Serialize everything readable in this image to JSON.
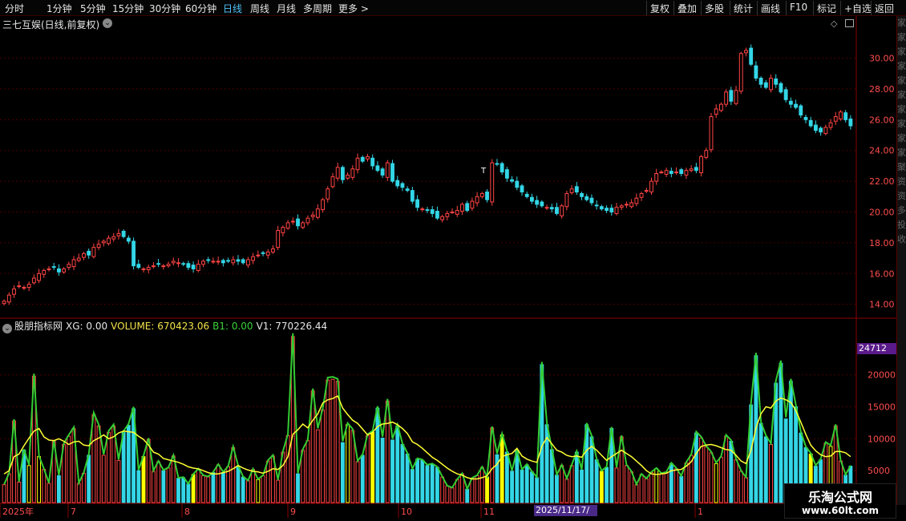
{
  "toolbar": {
    "periods": [
      "分时",
      "1分钟",
      "5分钟",
      "15分钟",
      "30分钟",
      "60分钟",
      "日线",
      "周线",
      "月线",
      "多周期",
      "更多 >"
    ],
    "active_period": "日线",
    "right_buttons": [
      "复权",
      "叠加",
      "多股",
      "统计",
      "画线",
      "F10",
      "标记",
      "+自选",
      "返回"
    ]
  },
  "price_panel": {
    "title": "三七互娱(日线,前复权)",
    "annotation": "T"
  },
  "indicator": {
    "name": "股朋指标网",
    "xg": "XG: 0.00",
    "volume": "VOLUME: 670423.06",
    "b1": "B1: 0.00",
    "v1": "V1: 770226.44"
  },
  "volume_tag": "24712",
  "date_tag": "2025/11/17/—",
  "x_axis_labels": [
    "2025年",
    "7",
    "8",
    "9",
    "10",
    "11",
    "1"
  ],
  "watermark": {
    "line1": "乐淘公式网",
    "line2": "www.60lt.com"
  },
  "right_strip_text": "家家家家家家家家家家聚资资多投收",
  "colors": {
    "up": "#ff4444",
    "down": "#33d6e6",
    "ma": "#ffff33",
    "green": "#33cc33",
    "axis": "#8b0000",
    "label": "#ff4d4d"
  },
  "chart_data": {
    "type": "candlestick",
    "price_axis": {
      "ticks": [
        "14.00",
        "16.00",
        "18.00",
        "20.00",
        "22.00",
        "24.00",
        "26.00",
        "28.00",
        "30.00"
      ],
      "ylim": [
        13.2,
        31.8
      ]
    },
    "volume_axis": {
      "ticks": [
        "5000",
        "10000",
        "15000",
        "20000"
      ],
      "ylim": [
        0,
        28000
      ]
    },
    "closes": [
      14.2,
      14.6,
      15.0,
      15.2,
      15.1,
      15.3,
      15.7,
      16.0,
      16.2,
      16.3,
      16.4,
      16.1,
      16.3,
      16.6,
      16.9,
      17.0,
      17.3,
      17.2,
      17.7,
      17.9,
      18.1,
      18.3,
      18.4,
      18.6,
      18.4,
      18.1,
      16.5,
      16.4,
      16.3,
      16.4,
      16.5,
      16.6,
      16.5,
      16.6,
      16.8,
      16.7,
      16.6,
      16.4,
      16.3,
      16.6,
      16.8,
      16.9,
      16.8,
      16.8,
      16.7,
      16.8,
      16.9,
      16.8,
      16.7,
      16.9,
      17.1,
      17.2,
      17.3,
      17.4,
      17.6,
      18.8,
      19.0,
      19.3,
      19.4,
      19.1,
      19.3,
      19.6,
      19.8,
      20.2,
      20.8,
      21.5,
      22.3,
      22.9,
      22.1,
      22.4,
      22.8,
      23.5,
      23.3,
      23.6,
      23.0,
      22.7,
      22.4,
      23.2,
      22.0,
      21.7,
      21.6,
      21.4,
      20.7,
      20.3,
      20.2,
      20.1,
      19.9,
      19.6,
      19.7,
      19.9,
      20.0,
      20.1,
      20.5,
      20.1,
      20.7,
      21.0,
      21.2,
      20.8,
      23.2,
      23.1,
      22.6,
      22.2,
      22.0,
      21.6,
      21.3,
      21.0,
      20.7,
      20.5,
      20.4,
      20.3,
      20.2,
      19.9,
      20.4,
      21.2,
      21.5,
      21.3,
      21.0,
      20.8,
      20.6,
      20.4,
      20.2,
      20.1,
      20.0,
      20.3,
      20.4,
      20.5,
      20.6,
      20.9,
      21.2,
      21.4,
      22.0,
      22.5,
      22.6,
      22.7,
      22.5,
      22.6,
      22.5,
      22.7,
      22.8,
      22.7,
      23.6,
      24.0,
      26.2,
      26.7,
      27.0,
      27.8,
      27.2,
      27.9,
      30.3,
      30.5,
      29.6,
      28.7,
      28.3,
      28.1,
      28.7,
      28.3,
      27.8,
      27.3,
      27.0,
      26.8,
      26.3,
      26.0,
      25.6,
      25.3,
      25.2,
      25.5,
      25.8,
      26.2,
      26.5,
      26.0,
      25.6
    ],
    "volumes": [
      2800,
      4500,
      12800,
      3200,
      8200,
      5800,
      19800,
      7200,
      5200,
      3000,
      9600,
      4200,
      9100,
      10400,
      11600,
      3000,
      4600,
      7400,
      13800,
      12000,
      7400,
      11000,
      12000,
      6600,
      11000,
      12100,
      14700,
      5000,
      7200,
      9900,
      4900,
      6400,
      5000,
      5400,
      7300,
      3800,
      3900,
      2900,
      4400,
      5200,
      4200,
      4000,
      4700,
      5900,
      4700,
      5600,
      8600,
      5700,
      4000,
      3400,
      5200,
      3600,
      4200,
      6500,
      7300,
      3500,
      7900,
      10500,
      26000,
      4500,
      8200,
      9700,
      17500,
      11400,
      14500,
      19200,
      19300,
      19000,
      9400,
      12200,
      11300,
      6400,
      7400,
      10500,
      11000,
      14800,
      10100,
      15900,
      9800,
      12000,
      9100,
      7600,
      5200,
      6800,
      6600,
      5800,
      6000,
      5500,
      4000,
      2600,
      2300,
      3600,
      4500,
      2100,
      3800,
      4200,
      5500,
      4000,
      11700,
      7500,
      10600,
      7900,
      4900,
      8100,
      5100,
      5900,
      4800,
      3900,
      21600,
      12200,
      8300,
      4300,
      5800,
      3700,
      5800,
      7900,
      5100,
      12200,
      10300,
      6700,
      4900,
      5500,
      11600,
      5400,
      10300,
      5800,
      4800,
      2800,
      4400,
      3700,
      4700,
      5300,
      4500,
      4700,
      6100,
      5300,
      4100,
      6200,
      7400,
      10900,
      10100,
      8700,
      7800,
      6100,
      7100,
      10400,
      9600,
      6700,
      4900,
      3900,
      15300,
      23000,
      12400,
      10300,
      9100,
      18700,
      21800,
      13100,
      19000,
      15000,
      10900,
      8600,
      7600,
      5700,
      6700,
      9300,
      8800,
      12000,
      6500,
      4300,
      5700,
      3700
    ],
    "ma_volume": [
      4500,
      5000,
      7200,
      7600,
      8900,
      10100,
      11200,
      11600,
      10300,
      9800,
      9700,
      10000,
      9600,
      9100,
      9500,
      9600,
      9000,
      8900,
      9700,
      10100,
      10600,
      10000,
      10300,
      10900,
      11200,
      11100,
      11000,
      10400,
      9900,
      9000,
      7900,
      7600,
      6900,
      6700,
      6500,
      6300,
      6000,
      5600,
      5400,
      5300,
      5000,
      4700,
      4500,
      4500,
      4700,
      4900,
      5300,
      5800,
      5400,
      5100,
      4900,
      4800,
      4600,
      4900,
      5300,
      5200,
      5800,
      7200,
      10700,
      11400,
      12300,
      11700,
      12900,
      13900,
      15600,
      16100,
      16300,
      16700,
      14800,
      13800,
      12900,
      12400,
      11500,
      10600,
      11000,
      11900,
      12300,
      12400,
      12600,
      12200,
      11600,
      10800,
      9500,
      9100,
      8500,
      7800,
      7100,
      6600,
      6000,
      5400,
      4900,
      4500,
      4300,
      3900,
      3700,
      3700,
      3900,
      4200,
      5300,
      6000,
      7200,
      7500,
      7700,
      8500,
      7300,
      6800,
      6500,
      6300,
      8800,
      10200,
      9200,
      8200,
      7900,
      7400,
      7200,
      7300,
      7100,
      8200,
      8800,
      8200,
      7400,
      6600,
      7200,
      7700,
      8200,
      7700,
      7200,
      6500,
      5800,
      5000,
      4500,
      4400,
      4500,
      4600,
      5000,
      5100,
      5200,
      5700,
      6400,
      7700,
      8800,
      9000,
      9100,
      8900,
      8600,
      8300,
      8200,
      7400,
      6500,
      6100,
      8200,
      11700,
      13900,
      15000,
      14800,
      15900,
      16400,
      16100,
      15700,
      14400,
      12600,
      10700,
      9000,
      8100,
      7500,
      7200,
      7300,
      8000,
      8000,
      7800,
      7200,
      6400
    ],
    "labels": [
      "2025年",
      "7",
      "8",
      "9",
      "10",
      "11",
      "1"
    ]
  }
}
